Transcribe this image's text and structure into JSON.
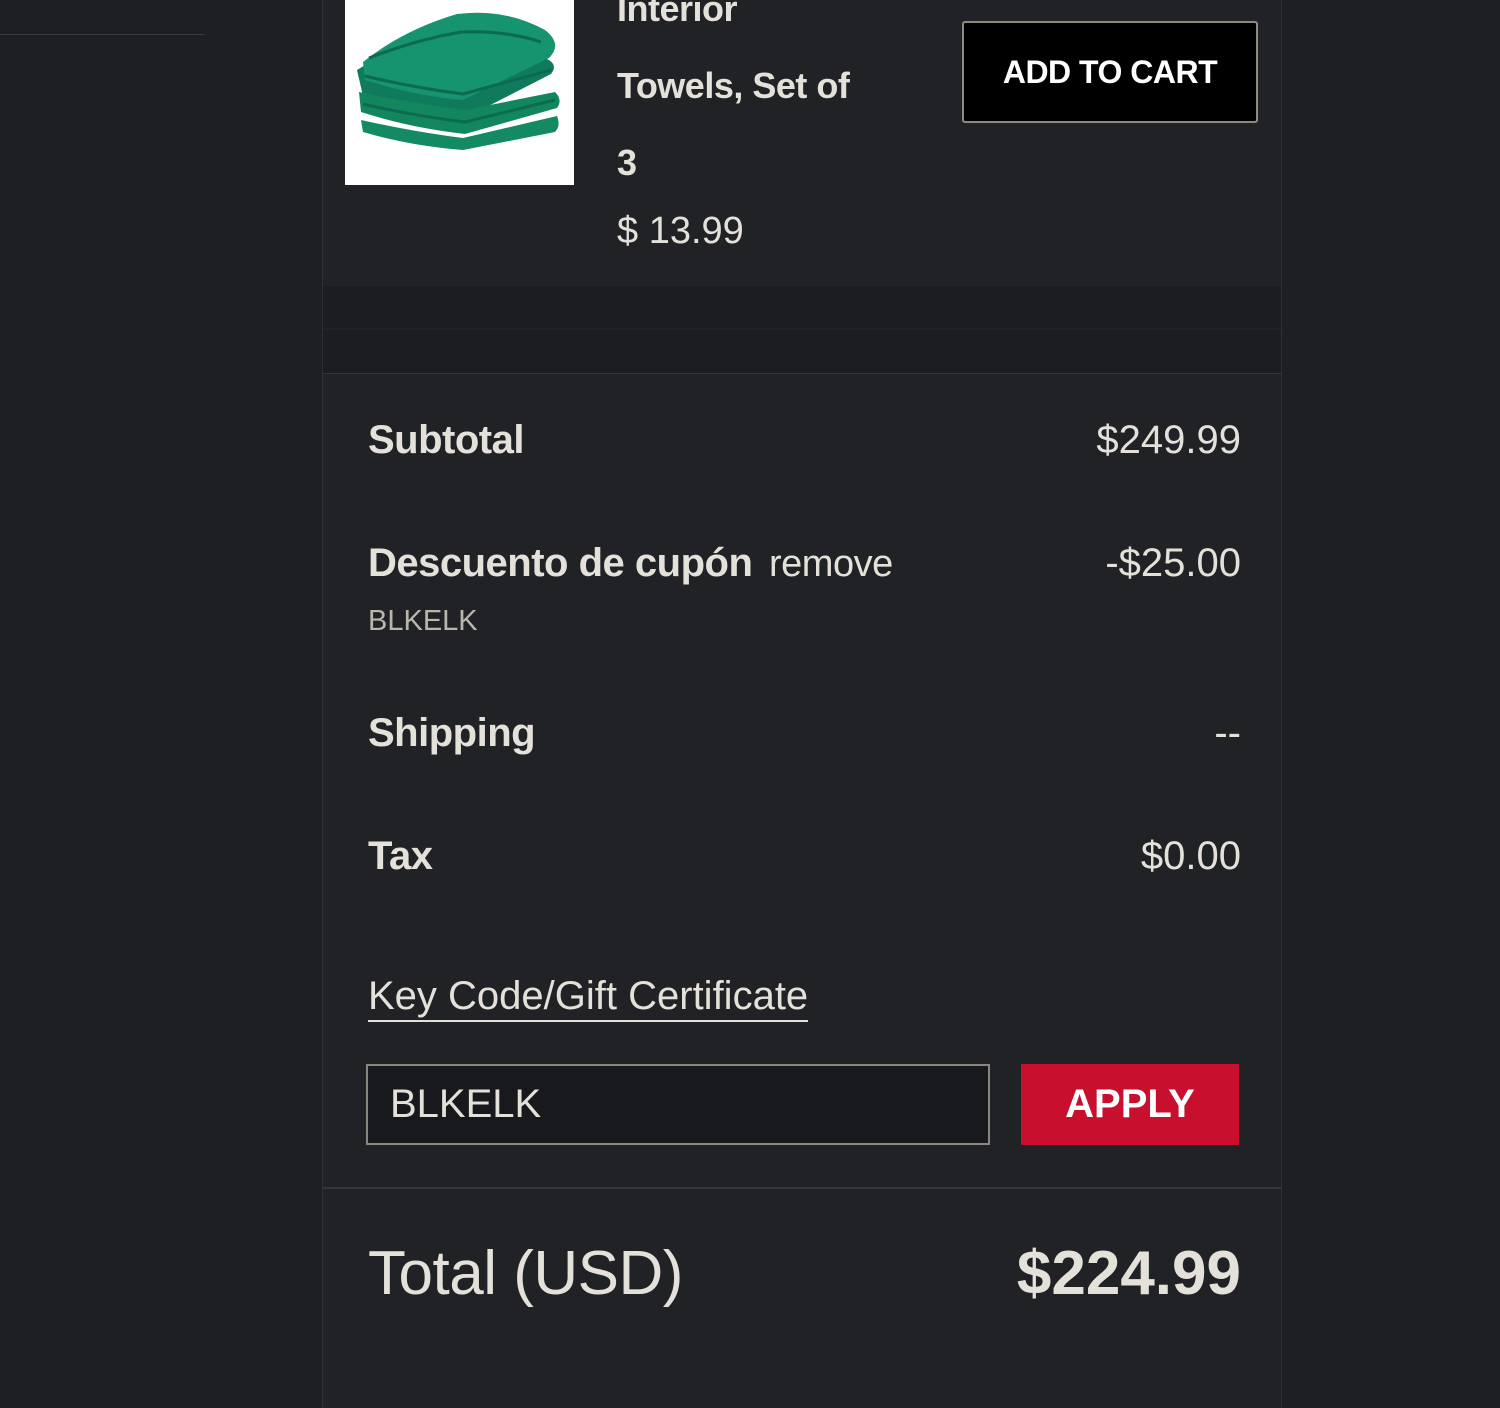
{
  "product": {
    "title_lines": [
      "Interior",
      "Towels, Set of",
      "3"
    ],
    "price": "$ 13.99",
    "add_to_cart_label": "ADD TO CART",
    "image_icon": "folded-green-towels-image"
  },
  "summary": {
    "subtotal_label": "Subtotal",
    "subtotal_value": "$249.99",
    "coupon_label": "Descuento de cupón",
    "remove_label": "remove",
    "coupon_value": "-$25.00",
    "coupon_code": "BLKELK",
    "shipping_label": "Shipping",
    "shipping_value": "--",
    "tax_label": "Tax",
    "tax_value": "$0.00",
    "keycode_label": "Key Code/Gift Certificate",
    "keycode_input_value": "BLKELK",
    "apply_label": "APPLY",
    "total_label": "Total (USD)",
    "total_value": "$224.99"
  },
  "colors": {
    "page_bg": "#1d1f22",
    "panel_bg": "#202225",
    "apply_button": "#c8102e",
    "towel_green": "#16936f"
  }
}
